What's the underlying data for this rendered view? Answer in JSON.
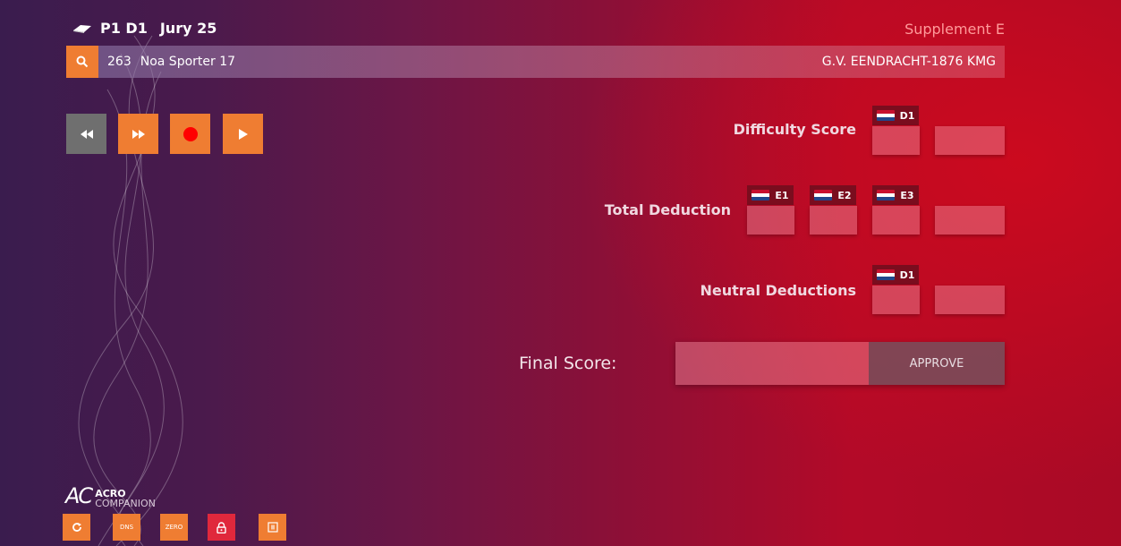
{
  "header": {
    "apparatus_icon": "mat-icon",
    "session": "P1 D1",
    "jury": "Jury 25",
    "supplement": "Supplement E"
  },
  "athlete": {
    "search_icon": "search-icon",
    "number": "263",
    "name": "Noa Sporter 17",
    "club": "G.V. EENDRACHT-1876 KMG"
  },
  "playback": [
    {
      "name": "rewind-button",
      "icon": "rewind-icon"
    },
    {
      "name": "fast-forward-button",
      "icon": "fast-forward-icon"
    },
    {
      "name": "record-button",
      "icon": "record-icon"
    },
    {
      "name": "play-button",
      "icon": "play-icon"
    }
  ],
  "scores": {
    "difficulty": {
      "label": "Difficulty Score",
      "judges": [
        "D1"
      ]
    },
    "total_deduction": {
      "label": "Total Deduction",
      "judges": [
        "E1",
        "E2",
        "E3"
      ]
    },
    "neutral": {
      "label": "Neutral Deductions",
      "judges": [
        "D1"
      ]
    }
  },
  "final": {
    "label": "Final Score:",
    "approve_label": "APPROVE"
  },
  "logo": {
    "mark": "AC",
    "line1": "ACRO",
    "line2": "COMPANION"
  },
  "utility": {
    "refresh_icon": "refresh-icon",
    "dns_label": "DNS",
    "zero_label": "ZERO",
    "lock_icon": "lock-icon",
    "pause_icon": "pause-icon"
  },
  "colors": {
    "accent_orange": "#ef7d32",
    "lock_red": "#e0283c",
    "record_red": "#ff0000",
    "flag": [
      "#c8102e",
      "#ffffff",
      "#21468b"
    ]
  }
}
